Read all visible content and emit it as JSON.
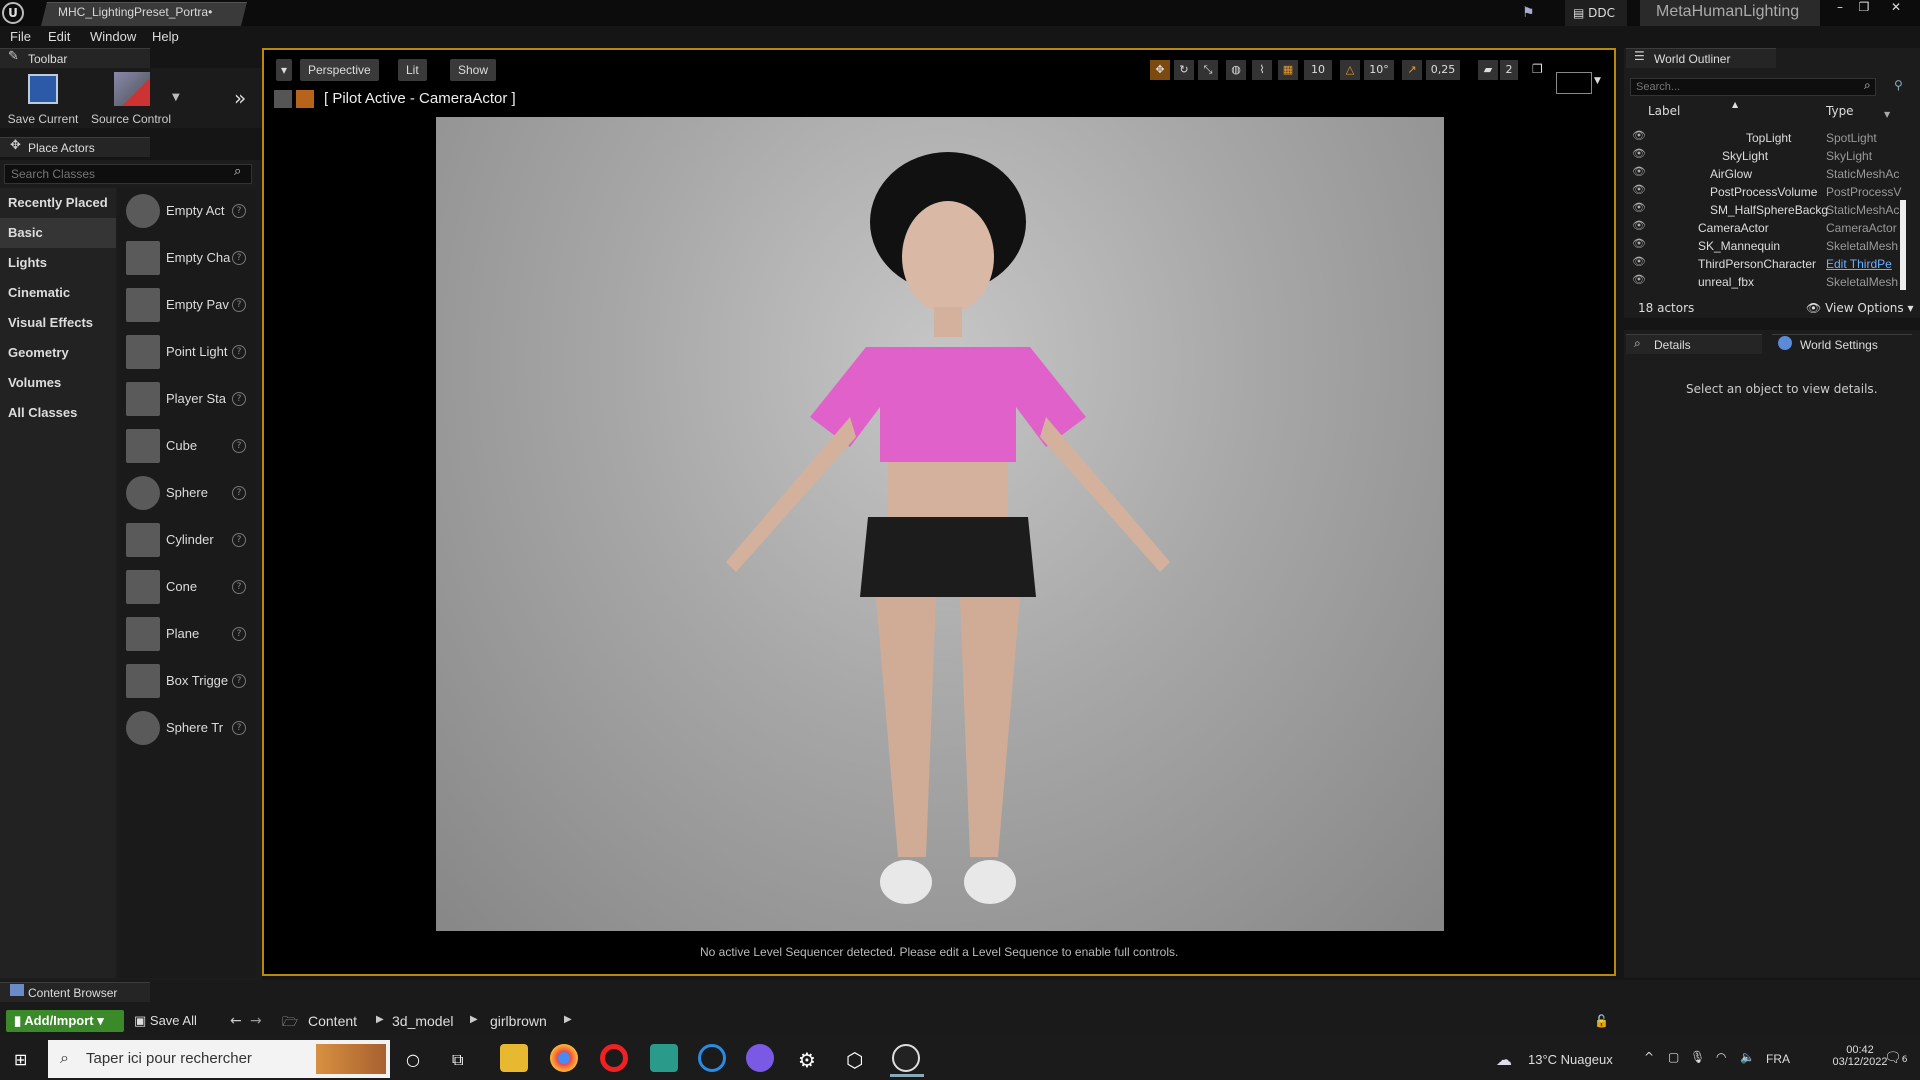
{
  "window": {
    "tab_title": "MHC_LightingPreset_Portra•",
    "ddc_label": "DDC",
    "project_name": "MetaHumanLighting"
  },
  "menu": [
    "File",
    "Edit",
    "Window",
    "Help"
  ],
  "toolbar": {
    "panel_title": "Toolbar",
    "save_current": "Save Current",
    "source_control": "Source Control"
  },
  "place_actors": {
    "panel_title": "Place Actors",
    "search_placeholder": "Search Classes",
    "categories": [
      "Recently Placed",
      "Basic",
      "Lights",
      "Cinematic",
      "Visual Effects",
      "Geometry",
      "Volumes",
      "All Classes"
    ],
    "selected_category": "Basic",
    "items": [
      "Empty Act",
      "Empty Cha",
      "Empty Pav",
      "Point Light",
      "Player Sta",
      "Cube",
      "Sphere",
      "Cylinder",
      "Cone",
      "Plane",
      "Box Trigge",
      "Sphere Tr"
    ]
  },
  "viewport": {
    "perspective": "Perspective",
    "lit": "Lit",
    "show": "Show",
    "pilot_label": "[ Pilot Active - CameraActor ]",
    "grid_snap": "10",
    "rotation_snap": "10°",
    "scale_snap": "0,25",
    "camera_speed": "2",
    "sequencer_message": "No active Level Sequencer detected. Please edit a Level Sequence to enable full controls."
  },
  "outliner": {
    "panel_title": "World Outliner",
    "search_placeholder": "Search...",
    "col_label": "Label",
    "col_type": "Type",
    "rows": [
      {
        "label": "TopLight",
        "type": "SpotLight"
      },
      {
        "label": "SkyLight",
        "type": "SkyLight"
      },
      {
        "label": "AirGlow",
        "type": "StaticMeshAc"
      },
      {
        "label": "PostProcessVolume",
        "type": "PostProcessV"
      },
      {
        "label": "SM_HalfSphereBackg",
        "type": "StaticMeshAc"
      },
      {
        "label": "CameraActor",
        "type": "CameraActor"
      },
      {
        "label": "SK_Mannequin",
        "type": "SkeletalMesh"
      },
      {
        "label": "ThirdPersonCharacter",
        "type": "Edit ThirdPe"
      },
      {
        "label": "unreal_fbx",
        "type": "SkeletalMesh"
      }
    ],
    "actor_count": "18 actors",
    "view_options": "View Options"
  },
  "details": {
    "tab_details": "Details",
    "tab_world_settings": "World Settings",
    "empty_message": "Select an object to view details."
  },
  "content_browser": {
    "panel_title": "Content Browser",
    "add_import": "Add/Import",
    "save_all": "Save All",
    "path": [
      "Content",
      "3d_model",
      "girlbrown"
    ]
  },
  "taskbar": {
    "search_placeholder": "Taper ici pour rechercher",
    "weather": "13°C  Nuageux",
    "lang": "FRA",
    "time": "00:42",
    "date": "03/12/2022",
    "notif_count": "6"
  }
}
